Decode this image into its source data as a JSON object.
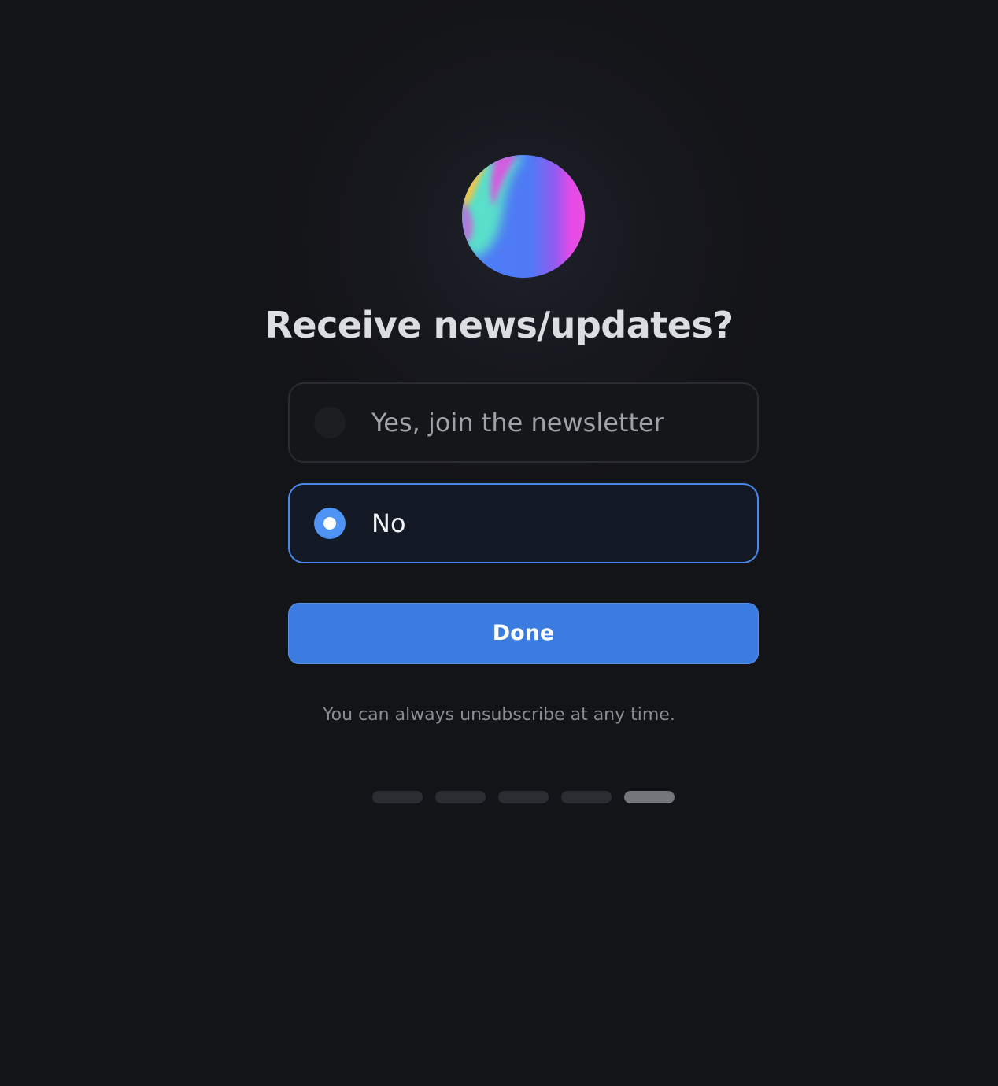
{
  "dialog": {
    "title": "Receive news/updates?",
    "options": [
      {
        "label": "Yes, join the newsletter",
        "selected": false
      },
      {
        "label": "No",
        "selected": true
      }
    ],
    "done_label": "Done",
    "footnote": "You can always unsubscribe at any time."
  },
  "progress": {
    "total_steps": 5,
    "current_step": 5
  },
  "colors": {
    "background": "#131417",
    "accent": "#3b7ce0",
    "selected_border": "#4a88ea",
    "orb_gradient": [
      "#f6c043",
      "#5ee6c4",
      "#4f7cf6",
      "#e64ce6"
    ]
  }
}
